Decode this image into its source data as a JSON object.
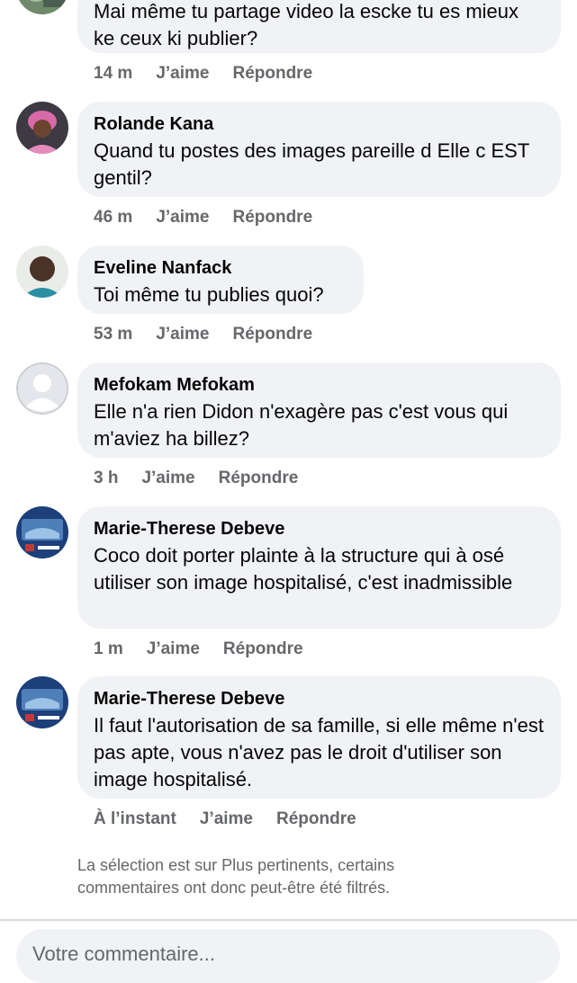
{
  "comments": [
    {
      "author": "",
      "text": "Mai même tu partage video la escke tu es mieux ke ceux ki publier?",
      "time": "14 m",
      "like": "J’aime",
      "reply": "Répondre"
    },
    {
      "author": "Rolande Kana",
      "text": "Quand tu postes des images pareille d Elle c EST gentil?",
      "time": "46 m",
      "like": "J’aime",
      "reply": "Répondre"
    },
    {
      "author": "Eveline Nanfack",
      "text": "Toi même tu publies quoi?",
      "time": "53 m",
      "like": "J’aime",
      "reply": "Répondre"
    },
    {
      "author": "Mefokam Mefokam",
      "text": "Elle n'a rien Didon n'exagère pas c'est vous qui m'aviez ha billez?",
      "time": "3 h",
      "like": "J’aime",
      "reply": "Répondre"
    },
    {
      "author": "Marie-Therese Debeve",
      "text": "Coco doit porter plainte à la structure qui à osé utiliser son image hospitalisé, c'est inadmissible",
      "time": "1 m",
      "like": "J’aime",
      "reply": "Répondre"
    },
    {
      "author": "Marie-Therese Debeve",
      "text": "Il faut l'autorisation de sa famille, si elle même n'est pas apte, vous n'avez pas le droit d'utiliser son image hospitalisé.",
      "time": "À l’instant",
      "like": "J’aime",
      "reply": "Répondre"
    }
  ],
  "filter_note": "La sélection est sur Plus pertinents, certains commentaires ont donc peut-être été filtrés.",
  "composer": {
    "placeholder": "Votre commentaire..."
  },
  "colors": {
    "bubble": "#f0f2f5",
    "secondary_text": "#65676b",
    "primary_text": "#050505"
  }
}
